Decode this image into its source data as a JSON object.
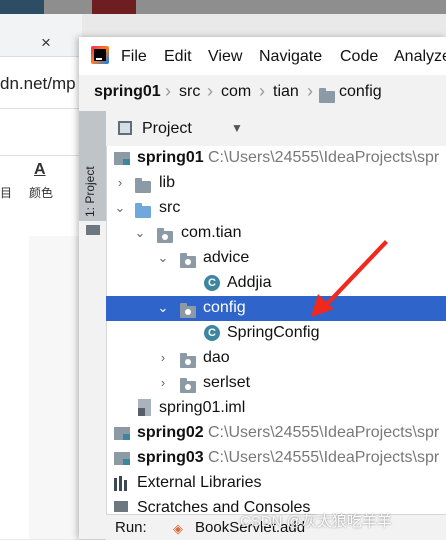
{
  "background": {
    "url_text": "dn.net/mp",
    "close_glyph": "×",
    "toolbar_icon": "A",
    "toolbar_label": "颜色",
    "toolbar_small": "目"
  },
  "ide": {
    "menu": [
      "File",
      "Edit",
      "View",
      "Navigate",
      "Code",
      "Analyze"
    ],
    "breadcrumb": [
      "spring01",
      "src",
      "com",
      "tian",
      "config"
    ],
    "side_tab": "1: Project",
    "project_panel_title": "Project",
    "tree": {
      "spring01": {
        "label": "spring01",
        "path": "C:\\Users\\24555\\IdeaProjects\\spr"
      },
      "lib": "lib",
      "src": "src",
      "com_tian": "com.tian",
      "advice": "advice",
      "addjia": "Addjia",
      "config": "config",
      "springconfig": "SpringConfig",
      "dao": "dao",
      "serlset": "serlset",
      "iml": "spring01.iml",
      "spring02": {
        "label": "spring02",
        "path": "C:\\Users\\24555\\IdeaProjects\\spr"
      },
      "spring03": {
        "label": "spring03",
        "path": "C:\\Users\\24555\\IdeaProjects\\spr"
      },
      "external_libraries": "External Libraries",
      "scratches": "Scratches and Consoles"
    },
    "run_bar": {
      "label": "Run:",
      "tab": "BookServlet.add"
    }
  },
  "watermark": "CSDN @灰太狼吃羊羊",
  "colors": {
    "selection": "#2f65ca",
    "class_icon": "#3e86a0",
    "annotation_arrow": "#f0281e"
  }
}
